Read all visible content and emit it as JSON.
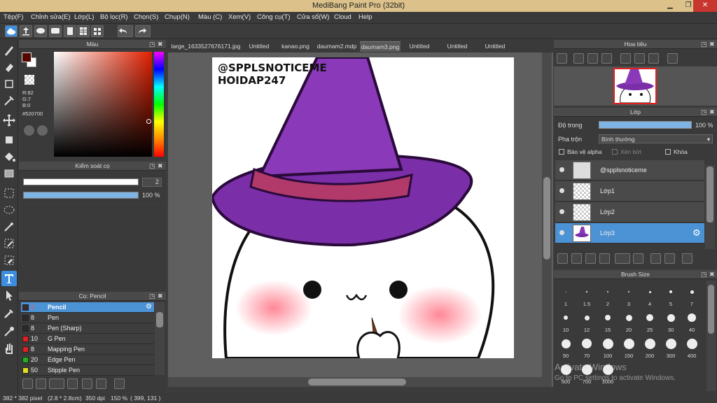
{
  "window": {
    "title": "MediBang Paint Pro (32bit)"
  },
  "menu": [
    "Tệp(F)",
    "Chỉnh sửa(E)",
    "Lớp(L)",
    "Bộ lọc(R)",
    "Chọn(S)",
    "Chụp(N)",
    "Màu (C)",
    "Xem(V)",
    "Công cụ(T)",
    "Cửa sổ(W)",
    "Cloud",
    "Help"
  ],
  "color_panel": {
    "title": "Màu",
    "r": "R:82",
    "g": "G:7",
    "b": "B:0",
    "hex": "#520700",
    "current_color": "#520700"
  },
  "brush_control": {
    "title": "Kiểm soát cọ",
    "size": "2",
    "opacity": "100 %"
  },
  "brush_panel": {
    "title": "Cọ: Pencil",
    "items": [
      {
        "size": "2",
        "name": "Pencil",
        "color": "#3c2a2a"
      },
      {
        "size": "8",
        "name": "Pen",
        "color": "#2a2a2a"
      },
      {
        "size": "8",
        "name": "Pen (Sharp)",
        "color": "#2a2a2a"
      },
      {
        "size": "10",
        "name": "G Pen",
        "color": "#e02020"
      },
      {
        "size": "8",
        "name": "Mapping Pen",
        "color": "#e02020"
      },
      {
        "size": "20",
        "name": "Edge Pen",
        "color": "#20b020"
      },
      {
        "size": "50",
        "name": "Stipple Pen",
        "color": "#e0e020"
      }
    ]
  },
  "tabs": [
    "large_1633527676171.jpg",
    "Untitled",
    "kanao.png",
    "daumam2.mdp",
    "daumam3.png",
    "Untitled",
    "Untitled",
    "Untitled"
  ],
  "canvas": {
    "watermark_line1": "@SPPLSNOTICEME",
    "watermark_line2": "HOIDAP247"
  },
  "navigator": {
    "title": "Hoa tiêu"
  },
  "layer_panel": {
    "title": "Lớp",
    "opacity_label": "Độ trong",
    "opacity_value": "100 %",
    "blend_label": "Pha trộn",
    "blend_value": "Bình thường",
    "protect_alpha": "Bảo vệ alpha",
    "clipping": "Xén bớt",
    "lock": "Khóa",
    "layers": [
      {
        "name": "@spplsnoticeme"
      },
      {
        "name": "Lớp1"
      },
      {
        "name": "Lớp2"
      },
      {
        "name": "Lớp3"
      }
    ]
  },
  "brush_size_panel": {
    "title": "Brush Size",
    "sizes": [
      "1",
      "1.5",
      "2",
      "3",
      "4",
      "5",
      "7",
      "10",
      "12",
      "15",
      "20",
      "25",
      "30",
      "40",
      "50",
      "70",
      "100",
      "150",
      "200",
      "300",
      "400",
      "500",
      "700",
      "1000"
    ]
  },
  "status": {
    "size": "382 * 382 pixel",
    "cm": "(2.8 * 2.8cm)",
    "dpi": "350 dpi",
    "zoom": "150 %",
    "coords": "( 399, 131 )"
  },
  "watermark_os": {
    "line1": "Activate Windows",
    "line2": "Go to PC settings to activate Windows."
  }
}
